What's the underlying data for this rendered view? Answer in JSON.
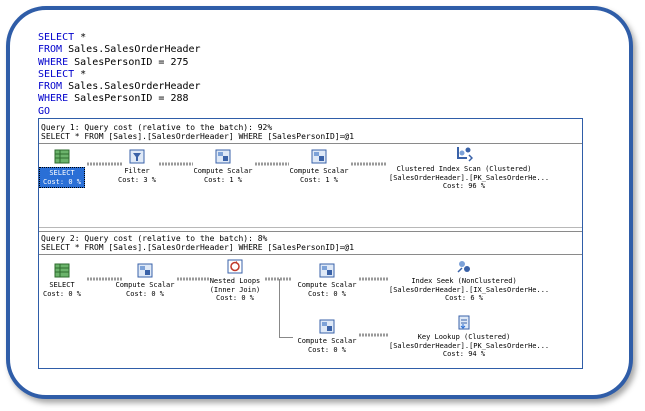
{
  "sql": {
    "lines": [
      {
        "kw": "SELECT",
        "rest": " *"
      },
      {
        "kw": "FROM",
        "rest": " Sales.SalesOrderHeader"
      },
      {
        "kw": "WHERE",
        "rest": " SalesPersonID = 275"
      },
      {
        "kw": "SELECT",
        "rest": " *"
      },
      {
        "kw": "FROM",
        "rest": " Sales.SalesOrderHeader"
      },
      {
        "kw": "WHERE",
        "rest": " SalesPersonID = 288"
      },
      {
        "kw": "GO",
        "rest": ""
      }
    ]
  },
  "query1": {
    "header": "Query 1: Query cost (relative to the batch): 92%",
    "statement": "SELECT * FROM [Sales].[SalesOrderHeader] WHERE [SalesPersonID]=@1",
    "nodes": {
      "select": {
        "label": "SELECT",
        "cost": "Cost: 0 %",
        "icon": "select-icon"
      },
      "filter": {
        "label": "Filter",
        "cost": "Cost: 3 %",
        "icon": "filter-icon"
      },
      "compute1": {
        "label": "Compute Scalar",
        "cost": "Cost: 1 %",
        "icon": "compute-scalar-icon"
      },
      "compute2": {
        "label": "Compute Scalar",
        "cost": "Cost: 1 %",
        "icon": "compute-scalar-icon"
      },
      "scan": {
        "label": "Clustered Index Scan (Clustered)",
        "sub": "[SalesOrderHeader].[PK_SalesOrderHe...",
        "cost": "Cost: 96 %",
        "icon": "clustered-index-scan-icon"
      }
    }
  },
  "query2": {
    "header": "Query 2: Query cost (relative to the batch): 8%",
    "statement": "SELECT * FROM [Sales].[SalesOrderHeader] WHERE [SalesPersonID]=@1",
    "nodes": {
      "select": {
        "label": "SELECT",
        "cost": "Cost: 0 %",
        "icon": "select-icon"
      },
      "compute1": {
        "label": "Compute Scalar",
        "cost": "Cost: 0 %",
        "icon": "compute-scalar-icon"
      },
      "loops": {
        "label": "Nested Loops",
        "sub": "(Inner Join)",
        "cost": "Cost: 0 %",
        "icon": "nested-loops-icon"
      },
      "compute2": {
        "label": "Compute Scalar",
        "cost": "Cost: 0 %",
        "icon": "compute-scalar-icon"
      },
      "seek": {
        "label": "Index Seek (NonClustered)",
        "sub": "[SalesOrderHeader].[IX_SalesOrderHe...",
        "cost": "Cost: 6 %",
        "icon": "index-seek-icon"
      },
      "compute3": {
        "label": "Compute Scalar",
        "cost": "Cost: 0 %",
        "icon": "compute-scalar-icon"
      },
      "lookup": {
        "label": "Key Lookup (Clustered)",
        "sub": "[SalesOrderHeader].[PK_SalesOrderHe...",
        "cost": "Cost: 94 %",
        "icon": "key-lookup-icon"
      }
    }
  },
  "colors": {
    "frame": "#2f5da8",
    "keyword": "#0000cc",
    "selection": "#2a6fd6"
  }
}
